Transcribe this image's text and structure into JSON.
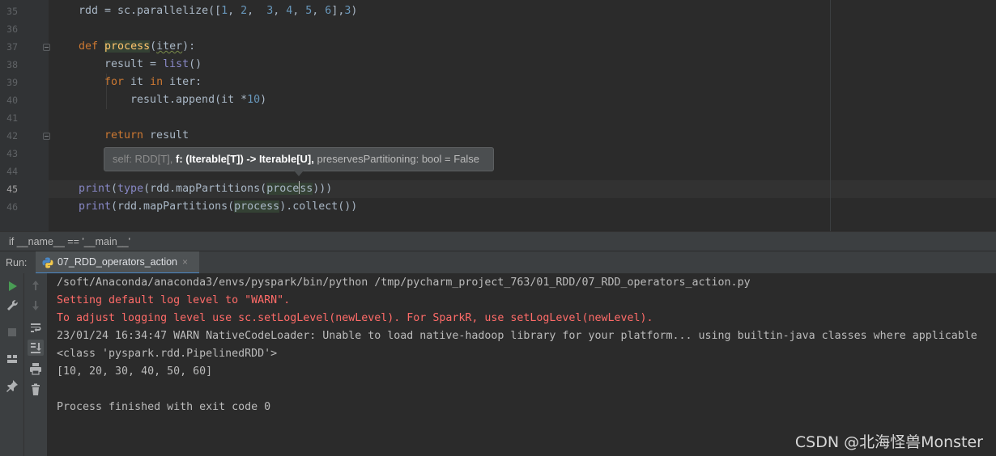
{
  "editor": {
    "line_numbers": [
      "35",
      "36",
      "37",
      "38",
      "39",
      "40",
      "41",
      "42",
      "43",
      "44",
      "45",
      "46"
    ],
    "active_line": "45",
    "code": {
      "l35": [
        "rdd = sc.parallelize([",
        "1",
        ", ",
        "2",
        ",  ",
        "3",
        ", ",
        "4",
        ", ",
        "5",
        ", ",
        "6",
        "],",
        "3",
        ")"
      ],
      "l37": [
        "def",
        " ",
        "process",
        "(",
        "iter",
        "):"
      ],
      "l38": [
        "result = ",
        "list",
        "()"
      ],
      "l39": [
        "for",
        " it ",
        "in",
        " iter:"
      ],
      "l40": [
        "result.append(it *",
        "10",
        ")"
      ],
      "l42": [
        "return",
        " result"
      ],
      "l45": [
        "print",
        "(",
        "type",
        "(rdd.mapPartitions(",
        "proce",
        "ss",
        ")))"
      ],
      "l46": [
        "print",
        "(rdd.mapPartitions(",
        "process",
        ").collect())"
      ]
    },
    "tooltip": {
      "param_self": "self: RDD[T],",
      "param_f": "f: (Iterable[T]) -> Iterable[U],",
      "param_rest": "preservesPartitioning: bool = False"
    }
  },
  "breadcrumb": {
    "text": "if __name__ == '__main__'"
  },
  "run": {
    "label": "Run:",
    "tab_title": "07_RDD_operators_action",
    "tab_close": "×"
  },
  "console": {
    "lines": [
      "/soft/Anaconda/anaconda3/envs/pyspark/bin/python /tmp/pycharm_project_763/01_RDD/07_RDD_operators_action.py",
      "Setting default log level to \"WARN\".",
      "To adjust logging level use sc.setLogLevel(newLevel). For SparkR, use setLogLevel(newLevel).",
      "23/01/24 16:34:47 WARN NativeCodeLoader: Unable to load native-hadoop library for your platform... using builtin-java classes where applicable",
      "<class 'pyspark.rdd.PipelinedRDD'>",
      "[10, 20, 30, 40, 50, 60]",
      "",
      "Process finished with exit code 0"
    ]
  },
  "watermark": "CSDN @北海怪兽Monster",
  "colors": {
    "keyword": "#cc7832",
    "function_def": "#ffc66d",
    "builtin": "#8888c6",
    "number": "#6897bb",
    "error_text": "#ff6b68",
    "run_icon": "#499c54",
    "tab_underline": "#4a88c7"
  },
  "icons": {
    "run": "play-icon",
    "settings": "wrench-icon",
    "stop": "stop-icon",
    "layout": "layout-icon",
    "pin": "pin-icon",
    "up": "arrow-up-icon",
    "down": "arrow-down-icon",
    "wrap": "soft-wrap-icon",
    "scroll": "scroll-to-end-icon",
    "print": "print-icon",
    "clear": "trash-icon",
    "python": "python-icon"
  }
}
